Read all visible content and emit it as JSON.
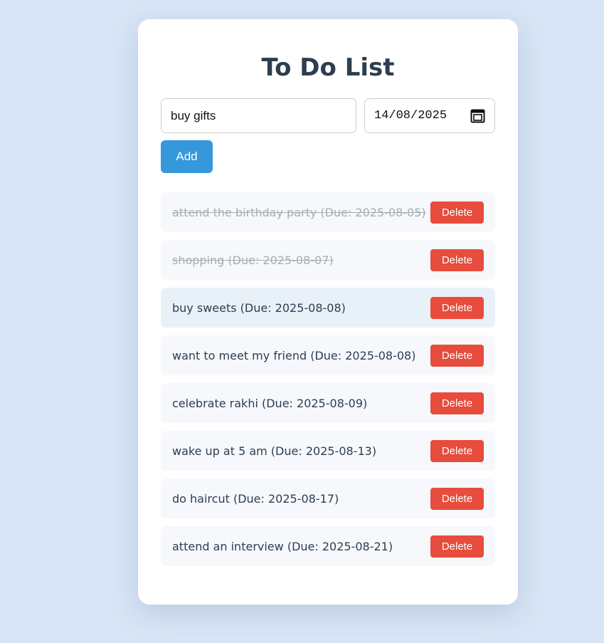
{
  "app": {
    "title": "To Do List"
  },
  "form": {
    "task_value": "buy gifts",
    "date_value": "14/08/2025",
    "add_label": "Add",
    "calendar_icon": "calendar-icon"
  },
  "tasks": [
    {
      "text": "attend the birthday party (Due: 2025-08-05)",
      "completed": true,
      "delete_label": "Delete"
    },
    {
      "text": "shopping (Due: 2025-08-07)",
      "completed": true,
      "delete_label": "Delete"
    },
    {
      "text": "buy sweets (Due: 2025-08-08)",
      "completed": false,
      "delete_label": "Delete"
    },
    {
      "text": "want to meet my friend (Due: 2025-08-08)",
      "completed": false,
      "delete_label": "Delete"
    },
    {
      "text": "celebrate rakhi (Due: 2025-08-09)",
      "completed": false,
      "delete_label": "Delete"
    },
    {
      "text": "wake up at 5 am (Due: 2025-08-13)",
      "completed": false,
      "delete_label": "Delete"
    },
    {
      "text": "do haircut (Due: 2025-08-17)",
      "completed": false,
      "delete_label": "Delete"
    },
    {
      "text": "attend an interview (Due: 2025-08-21)",
      "completed": false,
      "delete_label": "Delete"
    }
  ],
  "colors": {
    "page_background": "#d8e5f6",
    "card_background": "#ffffff",
    "title": "#2c3e50",
    "add_button": "#3498db",
    "delete_button": "#e74c3c",
    "completed_text": "#a7adb3",
    "item_background": "#f6f8fc",
    "hovered_item_background": "#e9f1f8"
  }
}
